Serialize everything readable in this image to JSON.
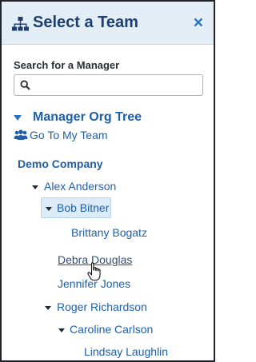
{
  "header": {
    "title": "Select a Team",
    "close_label": "×"
  },
  "search": {
    "label": "Search for a Manager",
    "value": "",
    "placeholder": ""
  },
  "org_tree": {
    "heading": "Manager Org Tree",
    "goto_label": "Go To My Team",
    "company": "Demo Company",
    "nodes": [
      {
        "name": "Alex Anderson",
        "expanded": true
      },
      {
        "name": "Bob Bitner",
        "expanded": true,
        "selected": true
      },
      {
        "name": "Brittany Bogatz"
      },
      {
        "name": "Debra Douglas",
        "hovered": true
      },
      {
        "name": "Jennifer Jones"
      },
      {
        "name": "Roger Richardson",
        "expanded": true
      },
      {
        "name": "Caroline Carlson",
        "expanded": true
      },
      {
        "name": "Lindsay Laughlin"
      }
    ]
  },
  "colors": {
    "header_bg": "#e3edf6",
    "title": "#1e3f6e",
    "link": "#1e5fa8",
    "accent": "#2b73c2",
    "selected_bg": "#dcebf8"
  }
}
